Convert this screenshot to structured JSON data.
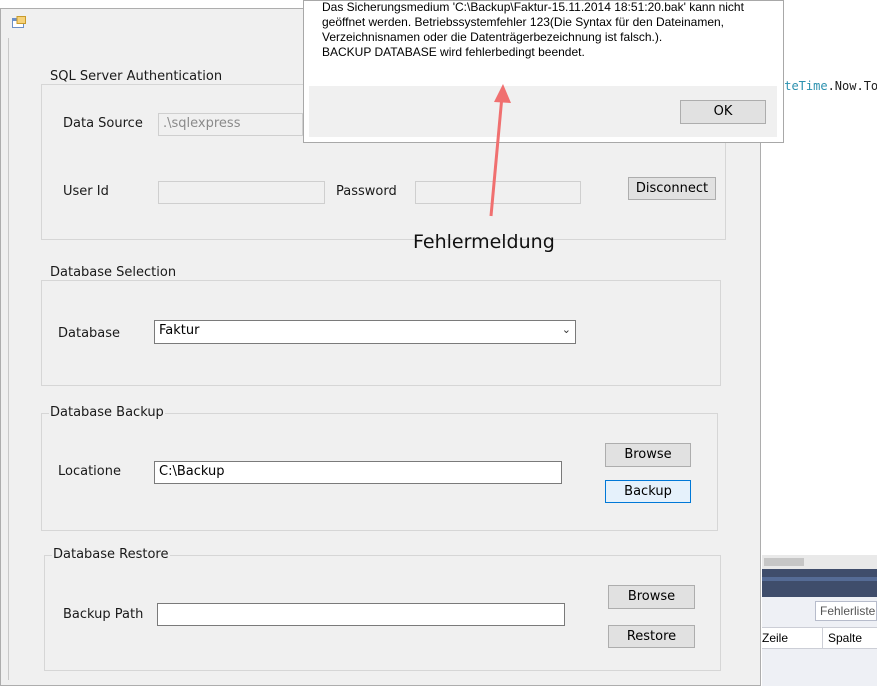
{
  "background_ide": {
    "code_prefix": "ateTime",
    "code_suffix": ".Now.To",
    "search_placeholder": "Fehlerliste",
    "columns": [
      "Zeile",
      "Spalte"
    ]
  },
  "form": {
    "sql_auth": {
      "legend": "SQL Server Authentication",
      "data_source_label": "Data Source",
      "data_source_value": ".\\sqlexpress",
      "user_id_label": "User Id",
      "user_id_value": "",
      "password_label": "Password",
      "password_value": "",
      "disconnect_label": "Disconnect"
    },
    "db_selection": {
      "legend": "Database Selection",
      "database_label": "Database",
      "database_value": "Faktur"
    },
    "db_backup": {
      "legend": "Database Backup",
      "location_label": "Locatione",
      "location_value": "C:\\Backup",
      "browse_label": "Browse",
      "backup_label": "Backup"
    },
    "db_restore": {
      "legend": "Database Restore",
      "backup_path_label": "Backup Path",
      "backup_path_value": "",
      "browse_label": "Browse",
      "restore_label": "Restore"
    }
  },
  "error_dialog": {
    "line1": "Das Sicherungsmedium 'C:\\Backup\\Faktur-15.11.2014 18:51:20.bak' kann nicht",
    "line2": "geöffnet werden. Betriebssystemfehler 123(Die Syntax für den Dateinamen,",
    "line3": "Verzeichnisnamen oder die Datenträgerbezeichnung ist falsch.).",
    "line4": "BACKUP DATABASE wird fehlerbedingt beendet.",
    "ok_label": "OK"
  },
  "annotation": {
    "text": "Fehlermeldung",
    "arrow_color": "#f07070"
  }
}
